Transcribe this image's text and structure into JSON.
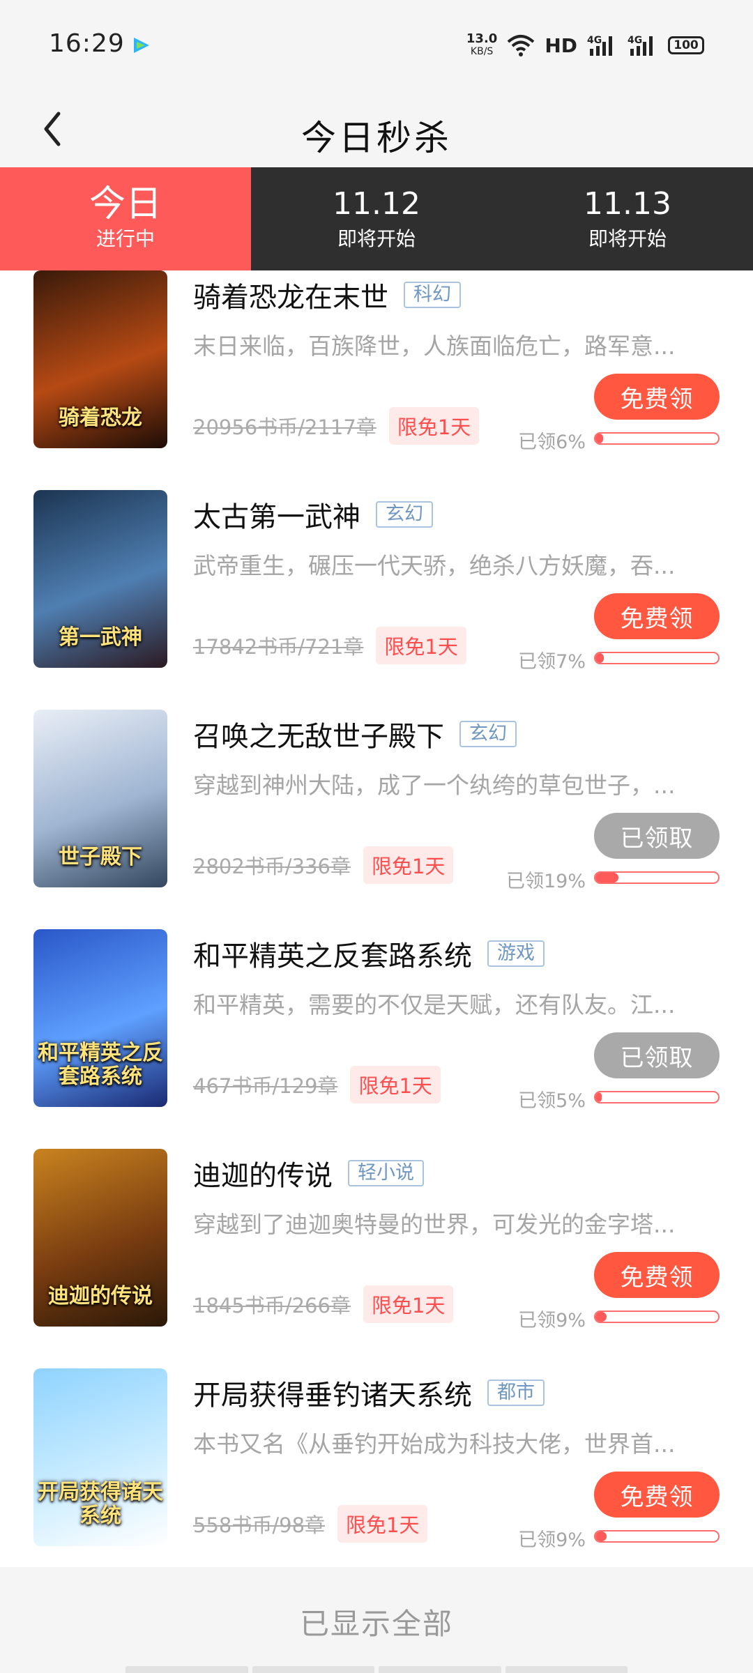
{
  "status_bar": {
    "time": "16:29",
    "net_speed": "13.0",
    "net_speed_unit": "KB/S",
    "hd_label": "HD",
    "battery": "100",
    "signal1_label": "4G",
    "signal2_label": "4G"
  },
  "header": {
    "title": "今日秒杀"
  },
  "tabs": [
    {
      "main": "今日",
      "sub": "进行中",
      "active": true
    },
    {
      "main": "11.12",
      "sub": "即将开始",
      "active": false
    },
    {
      "main": "11.13",
      "sub": "即将开始",
      "active": false
    }
  ],
  "books": [
    {
      "title": "骑着恐龙在末世",
      "genre": "科幻",
      "desc": "末日来临，百族降世，人族面临危亡，路军意...",
      "price": "20956书币/2117章",
      "badge": "限免1天",
      "button": "免费领",
      "claimed": false,
      "progress_label": "已领6%",
      "progress": 6,
      "cover_text": "骑着恐龙",
      "cover_colors": [
        "#3a1a0a",
        "#b64a14",
        "#1d0c06"
      ]
    },
    {
      "title": "太古第一武神",
      "genre": "玄幻",
      "desc": "武帝重生，碾压一代天骄，绝杀八方妖魔，吞...",
      "price": "17842书币/721章",
      "badge": "限免1天",
      "button": "免费领",
      "claimed": false,
      "progress_label": "已领7%",
      "progress": 7,
      "cover_text": "第一武神",
      "cover_colors": [
        "#1c3552",
        "#4f7fb2",
        "#2b1a22"
      ]
    },
    {
      "title": "召唤之无敌世子殿下",
      "genre": "玄幻",
      "desc": "穿越到神州大陆，成了一个纨绔的草包世子，...",
      "price": "2802书币/336章",
      "badge": "限免1天",
      "button": "已领取",
      "claimed": true,
      "progress_label": "已领19%",
      "progress": 19,
      "cover_text": "世子殿下",
      "cover_colors": [
        "#e9eef6",
        "#9fb5d2",
        "#33465e"
      ]
    },
    {
      "title": "和平精英之反套路系统",
      "genre": "游戏",
      "desc": "和平精英，需要的不仅是天赋，还有队友。江...",
      "price": "467书币/129章",
      "badge": "限免1天",
      "button": "已领取",
      "claimed": true,
      "progress_label": "已领5%",
      "progress": 5,
      "cover_text": "和平精英之反套路系统",
      "cover_colors": [
        "#2a57c8",
        "#5fa0ff",
        "#1a2a72"
      ]
    },
    {
      "title": "迪迦的传说",
      "genre": "轻小说",
      "desc": "穿越到了迪迦奥特曼的世界，可发光的金字塔...",
      "price": "1845书币/266章",
      "badge": "限免1天",
      "button": "免费领",
      "claimed": false,
      "progress_label": "已领9%",
      "progress": 9,
      "cover_text": "迪迦的传说",
      "cover_colors": [
        "#c9831f",
        "#7a3d10",
        "#2a1808"
      ]
    },
    {
      "title": "开局获得垂钓诸天系统",
      "genre": "都市",
      "desc": "本书又名《从垂钓开始成为科技大佬，世界首...",
      "price": "558书币/98章",
      "badge": "限免1天",
      "button": "免费领",
      "claimed": false,
      "progress_label": "已领9%",
      "progress": 9,
      "cover_text": "开局获得诸天系统",
      "cover_colors": [
        "#8fd3ff",
        "#c9ecff",
        "#ffffff"
      ]
    }
  ],
  "footer": {
    "text": "已显示全部"
  }
}
